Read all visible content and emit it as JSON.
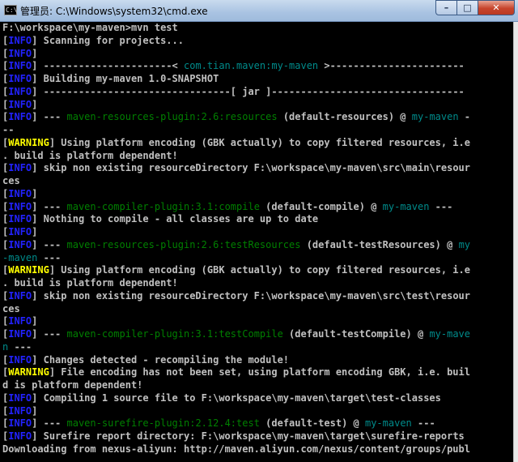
{
  "window": {
    "title": "管理员: C:\\Windows\\system32\\cmd.exe",
    "icon": "cmd-icon",
    "controls": {
      "minimize": "–",
      "maximize": "□",
      "close": "✕"
    }
  },
  "colors": {
    "info": "#2222ff",
    "warning": "#ffff00",
    "plugin": "#008000",
    "artifact": "#008b8b",
    "text": "#c0c0c0"
  },
  "console": {
    "lines": [
      [
        [
          "gray",
          "F:\\workspace\\my-maven>mvn test"
        ]
      ],
      [
        [
          "gray",
          "["
        ],
        [
          "blue",
          "INFO"
        ],
        [
          "gray",
          "] Scanning for projects..."
        ]
      ],
      [
        [
          "gray",
          "["
        ],
        [
          "blue",
          "INFO"
        ],
        [
          "gray",
          "]"
        ]
      ],
      [
        [
          "gray",
          "["
        ],
        [
          "blue",
          "INFO"
        ],
        [
          "gray",
          "] ----------------------< "
        ],
        [
          "cyan",
          "com.tian.maven:my-maven"
        ],
        [
          "gray",
          " >-----------------------"
        ]
      ],
      [
        [
          "gray",
          "["
        ],
        [
          "blue",
          "INFO"
        ],
        [
          "gray",
          "] Building my-maven 1.0-SNAPSHOT"
        ]
      ],
      [
        [
          "gray",
          "["
        ],
        [
          "blue",
          "INFO"
        ],
        [
          "gray",
          "] --------------------------------[ jar ]---------------------------------"
        ]
      ],
      [
        [
          "gray",
          "["
        ],
        [
          "blue",
          "INFO"
        ],
        [
          "gray",
          "]"
        ]
      ],
      [
        [
          "gray",
          "["
        ],
        [
          "blue",
          "INFO"
        ],
        [
          "gray",
          "] --- "
        ],
        [
          "green",
          "maven-resources-plugin:2.6:resources"
        ],
        [
          "gray",
          " (default-resources) @ "
        ],
        [
          "cyan",
          "my-maven"
        ],
        [
          "gray",
          " -"
        ]
      ],
      [
        [
          "gray",
          "--"
        ]
      ],
      [
        [
          "gray",
          "["
        ],
        [
          "yellow",
          "WARNING"
        ],
        [
          "gray",
          "] Using platform encoding (GBK actually) to copy filtered resources, i.e"
        ]
      ],
      [
        [
          "gray",
          ". build is platform dependent!"
        ]
      ],
      [
        [
          "gray",
          "["
        ],
        [
          "blue",
          "INFO"
        ],
        [
          "gray",
          "] skip non existing resourceDirectory F:\\workspace\\my-maven\\src\\main\\resour"
        ]
      ],
      [
        [
          "gray",
          "ces"
        ]
      ],
      [
        [
          "gray",
          "["
        ],
        [
          "blue",
          "INFO"
        ],
        [
          "gray",
          "]"
        ]
      ],
      [
        [
          "gray",
          "["
        ],
        [
          "blue",
          "INFO"
        ],
        [
          "gray",
          "] --- "
        ],
        [
          "green",
          "maven-compiler-plugin:3.1:compile"
        ],
        [
          "gray",
          " (default-compile) @ "
        ],
        [
          "cyan",
          "my-maven"
        ],
        [
          "gray",
          " ---"
        ]
      ],
      [
        [
          "gray",
          "["
        ],
        [
          "blue",
          "INFO"
        ],
        [
          "gray",
          "] Nothing to compile - all classes are up to date"
        ]
      ],
      [
        [
          "gray",
          "["
        ],
        [
          "blue",
          "INFO"
        ],
        [
          "gray",
          "]"
        ]
      ],
      [
        [
          "gray",
          "["
        ],
        [
          "blue",
          "INFO"
        ],
        [
          "gray",
          "] --- "
        ],
        [
          "green",
          "maven-resources-plugin:2.6:testResources"
        ],
        [
          "gray",
          " (default-testResources) @ "
        ],
        [
          "cyan",
          "my"
        ]
      ],
      [
        [
          "cyan",
          "-maven"
        ],
        [
          "gray",
          " ---"
        ]
      ],
      [
        [
          "gray",
          "["
        ],
        [
          "yellow",
          "WARNING"
        ],
        [
          "gray",
          "] Using platform encoding (GBK actually) to copy filtered resources, i.e"
        ]
      ],
      [
        [
          "gray",
          ". build is platform dependent!"
        ]
      ],
      [
        [
          "gray",
          "["
        ],
        [
          "blue",
          "INFO"
        ],
        [
          "gray",
          "] skip non existing resourceDirectory F:\\workspace\\my-maven\\src\\test\\resour"
        ]
      ],
      [
        [
          "gray",
          "ces"
        ]
      ],
      [
        [
          "gray",
          "["
        ],
        [
          "blue",
          "INFO"
        ],
        [
          "gray",
          "]"
        ]
      ],
      [
        [
          "gray",
          "["
        ],
        [
          "blue",
          "INFO"
        ],
        [
          "gray",
          "] --- "
        ],
        [
          "green",
          "maven-compiler-plugin:3.1:testCompile"
        ],
        [
          "gray",
          " (default-testCompile) @ "
        ],
        [
          "cyan",
          "my-mave"
        ]
      ],
      [
        [
          "cyan",
          "n"
        ],
        [
          "gray",
          " ---"
        ]
      ],
      [
        [
          "gray",
          "["
        ],
        [
          "blue",
          "INFO"
        ],
        [
          "gray",
          "] Changes detected - recompiling the module!"
        ]
      ],
      [
        [
          "gray",
          "["
        ],
        [
          "yellow",
          "WARNING"
        ],
        [
          "gray",
          "] File encoding has not been set, using platform encoding GBK, i.e. buil"
        ]
      ],
      [
        [
          "gray",
          "d is platform dependent!"
        ]
      ],
      [
        [
          "gray",
          "["
        ],
        [
          "blue",
          "INFO"
        ],
        [
          "gray",
          "] Compiling 1 source file to F:\\workspace\\my-maven\\target\\test-classes"
        ]
      ],
      [
        [
          "gray",
          "["
        ],
        [
          "blue",
          "INFO"
        ],
        [
          "gray",
          "]"
        ]
      ],
      [
        [
          "gray",
          "["
        ],
        [
          "blue",
          "INFO"
        ],
        [
          "gray",
          "] --- "
        ],
        [
          "green",
          "maven-surefire-plugin:2.12.4:test"
        ],
        [
          "gray",
          " (default-test) @ "
        ],
        [
          "cyan",
          "my-maven"
        ],
        [
          "gray",
          " ---"
        ]
      ],
      [
        [
          "gray",
          "["
        ],
        [
          "blue",
          "INFO"
        ],
        [
          "gray",
          "] Surefire report directory: F:\\workspace\\my-maven\\target\\surefire-reports"
        ]
      ],
      [
        [
          "gray",
          "Downloading from nexus-aliyun: http://maven.aliyun.com/nexus/content/groups/publ"
        ]
      ]
    ]
  }
}
